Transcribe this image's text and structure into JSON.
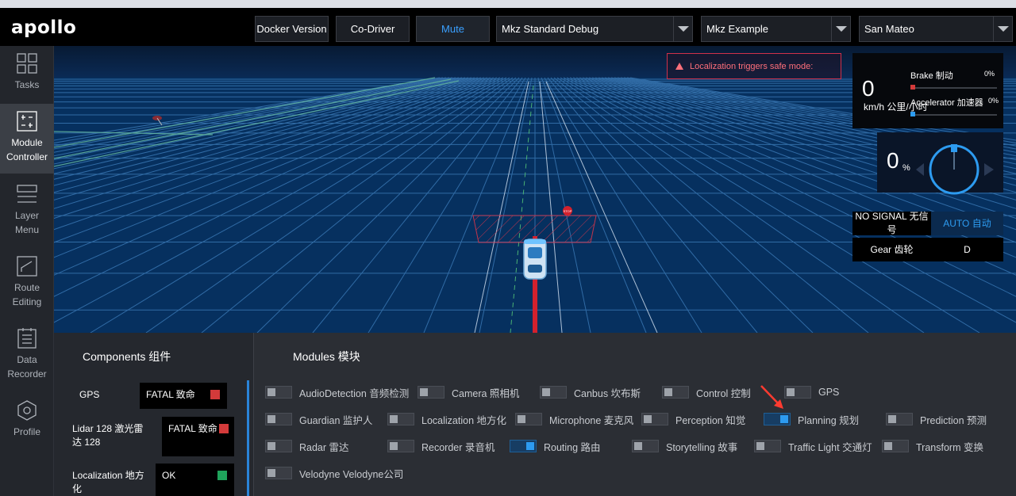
{
  "header": {
    "logo": "apollo",
    "buttons": {
      "docker": "Docker Version",
      "codriver": "Co-Driver",
      "mute": "Mute"
    },
    "selects": {
      "mode": "Mkz Standard Debug",
      "vehicle": "Mkz Example",
      "map": "San Mateo"
    }
  },
  "sidebar": {
    "items": [
      {
        "label_line1": "Tasks",
        "label_line2": "",
        "icon": "tasks-grid-icon"
      },
      {
        "label_line1": "Module",
        "label_line2": "Controller",
        "icon": "module-controller-icon",
        "active": true
      },
      {
        "label_line1": "Layer",
        "label_line2": "Menu",
        "icon": "layer-menu-icon"
      },
      {
        "label_line1": "Route",
        "label_line2": "Editing",
        "icon": "route-editing-icon"
      },
      {
        "label_line1": "Data",
        "label_line2": "Recorder",
        "icon": "data-recorder-icon"
      },
      {
        "label_line1": "Profile",
        "label_line2": "",
        "icon": "profile-hex-icon"
      }
    ]
  },
  "scene": {
    "alert": "Localization triggers safe mode:",
    "speed": {
      "value": "0",
      "unit": "km/h 公里/小时"
    },
    "brake": {
      "label": "Brake 制动",
      "pct": "0%"
    },
    "accelerator": {
      "label": "Accelerator 加速器",
      "pct": "0%"
    },
    "steering": {
      "value": "0",
      "unit": "%"
    },
    "signal": "NO SIGNAL 无信号",
    "drive_mode": "AUTO 自动",
    "gear_label": "Gear 齿轮",
    "gear_value": "D",
    "stop_sign": "STOP"
  },
  "components": {
    "title": "Components 组件",
    "items": [
      {
        "name": "GPS",
        "status": "FATAL 致命",
        "color": "#d33a3a"
      },
      {
        "name": "Lidar 128 激光雷达 128",
        "status": "FATAL 致命",
        "color": "#d33a3a"
      },
      {
        "name": "Localization 地方化",
        "status": "OK",
        "color": "#1fa35b"
      }
    ]
  },
  "modules": {
    "title": "Modules 模块",
    "items": [
      {
        "label": "AudioDetection 音频检测",
        "on": false
      },
      {
        "label": "Camera 照相机",
        "on": false
      },
      {
        "label": "Canbus 坎布斯",
        "on": false
      },
      {
        "label": "Control 控制",
        "on": false
      },
      {
        "label": "GPS",
        "on": false
      },
      {
        "label": "Guardian 监护人",
        "on": false
      },
      {
        "label": "Localization 地方化",
        "on": false
      },
      {
        "label": "Microphone 麦克风",
        "on": false
      },
      {
        "label": "Perception 知觉",
        "on": false
      },
      {
        "label": "Planning 规划",
        "on": true
      },
      {
        "label": "Prediction 预测",
        "on": false
      },
      {
        "label": "Radar 雷达",
        "on": false
      },
      {
        "label": "Recorder 录音机",
        "on": false
      },
      {
        "label": "Routing 路由",
        "on": true
      },
      {
        "label": "Storytelling 故事",
        "on": false
      },
      {
        "label": "Traffic Light 交通灯",
        "on": false
      },
      {
        "label": "Transform 变换",
        "on": false
      },
      {
        "label": "Velodyne Velodyne公司",
        "on": false
      }
    ]
  },
  "colors": {
    "accent": "#2d9bf0",
    "fatal": "#d33a3a",
    "ok": "#1fa35b",
    "alert": "#ff6f7a"
  }
}
